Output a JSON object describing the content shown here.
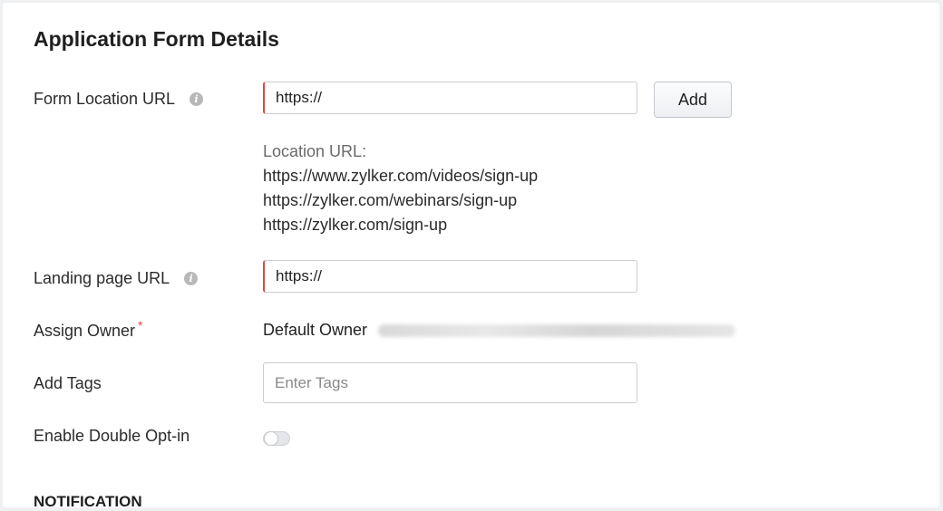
{
  "page": {
    "title": "Application Form Details"
  },
  "form_location": {
    "label": "Form Location URL",
    "value": "https://",
    "add_label": "Add",
    "heading": "Location URL:",
    "urls": [
      "https://www.zylker.com/videos/sign-up",
      "https://zylker.com/webinars/sign-up",
      "https://zylker.com/sign-up"
    ]
  },
  "landing_page": {
    "label": "Landing page URL",
    "value": "https://"
  },
  "assign_owner": {
    "label": "Assign Owner",
    "required_mark": "*",
    "value": "Default Owner"
  },
  "tags": {
    "label": "Add Tags",
    "placeholder": "Enter Tags"
  },
  "double_opt_in": {
    "label": "Enable Double Opt-in",
    "enabled": false
  },
  "notification": {
    "heading": "NOTIFICATION"
  },
  "icons": {
    "info": "info-icon",
    "info_glyph": "i"
  },
  "colors": {
    "required": "#e0473c",
    "error_border": "#e0473c"
  }
}
